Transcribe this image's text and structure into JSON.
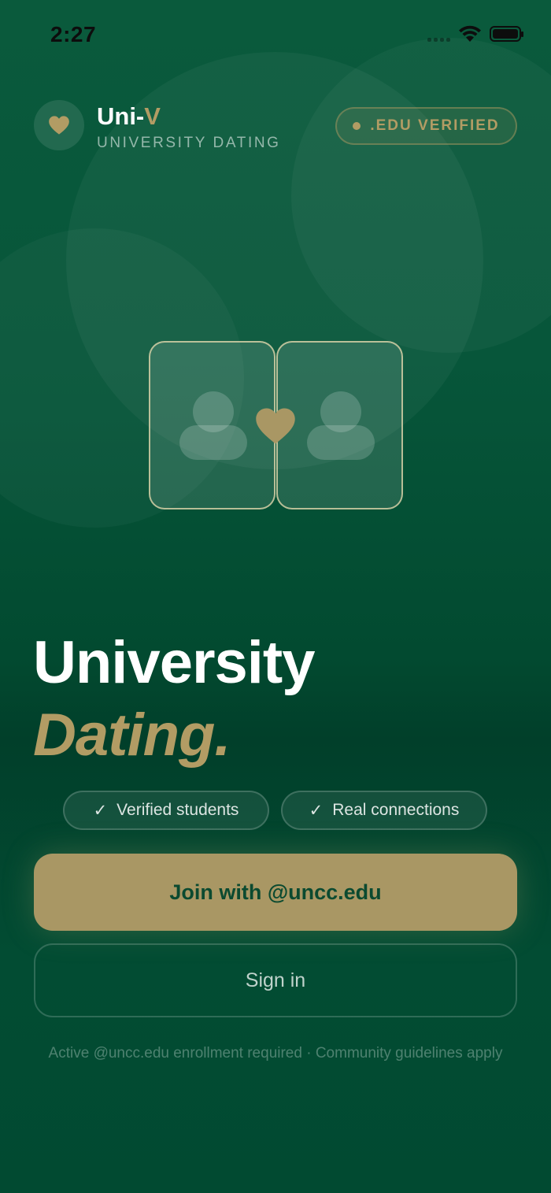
{
  "status_bar": {
    "time": "2:27"
  },
  "brand": {
    "name": "Uni-",
    "accent": "V",
    "subtitle": "UNIVERSITY DATING"
  },
  "badge": {
    "label": ".EDU VERIFIED"
  },
  "hero": {
    "line1": "University",
    "line2": "Dating."
  },
  "chips": [
    {
      "check": "✓",
      "label": "Verified students"
    },
    {
      "check": "✓",
      "label": "Real connections"
    }
  ],
  "actions": {
    "join_label": "Join with @uncc.edu",
    "signin_label": "Sign in"
  },
  "footnote": "Active @uncc.edu enrollment required · Community guidelines apply",
  "colors": {
    "accent": "#b29c64",
    "background": "#014a32",
    "button": "#a99764"
  },
  "icons": [
    "heart-icon",
    "wifi-icon",
    "battery-icon",
    "signal-icon",
    "person-icon",
    "check-icon"
  ]
}
